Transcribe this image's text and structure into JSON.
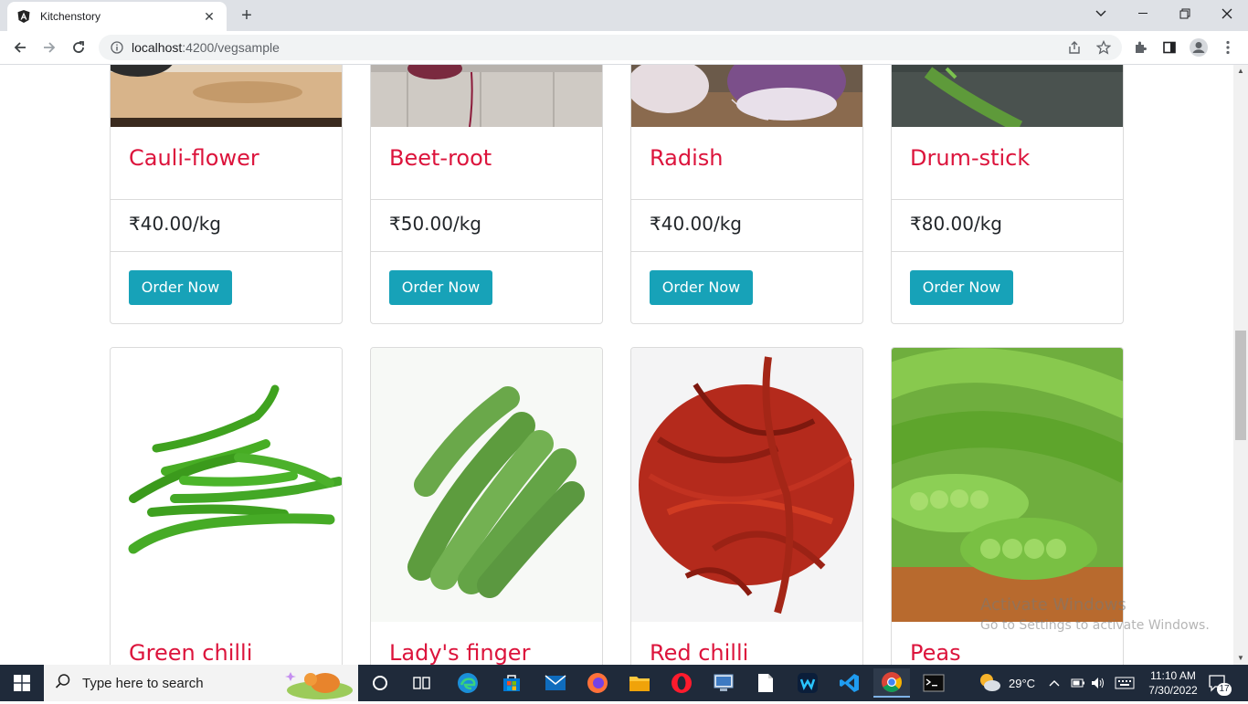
{
  "browser": {
    "tab_title": "Kitchenstory",
    "url_host": "localhost",
    "url_rest": ":4200/vegsample"
  },
  "top_row": [
    {
      "name": "Cauli-flower",
      "price": "₹40.00/kg",
      "button": "Order Now"
    },
    {
      "name": "Beet-root",
      "price": "₹50.00/kg",
      "button": "Order Now"
    },
    {
      "name": "Radish",
      "price": "₹40.00/kg",
      "button": "Order Now"
    },
    {
      "name": "Drum-stick",
      "price": "₹80.00/kg",
      "button": "Order Now"
    }
  ],
  "bottom_row": [
    {
      "name": "Green chilli"
    },
    {
      "name": "Lady's finger"
    },
    {
      "name": "Red chilli"
    },
    {
      "name": "Peas"
    }
  ],
  "watermark": {
    "line1": "Activate Windows",
    "line2": "Go to Settings to activate Windows."
  },
  "taskbar": {
    "search_placeholder": "Type here to search",
    "weather": "29°C",
    "time": "11:10 AM",
    "date": "7/30/2022",
    "notifications": "17"
  },
  "colors": {
    "title": "#dc143c",
    "button": "#17a2b8",
    "taskbar": "#1f2a3a"
  }
}
